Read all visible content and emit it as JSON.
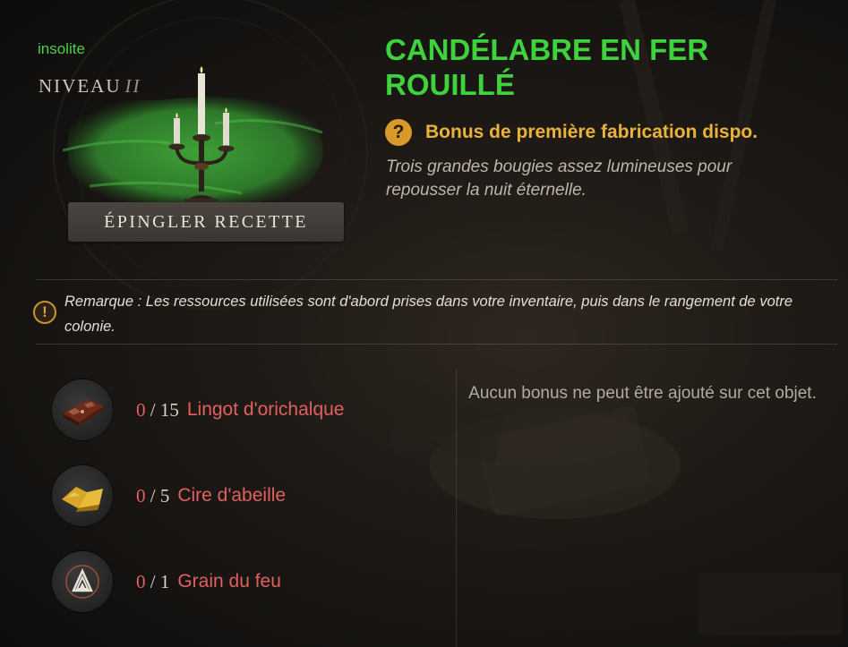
{
  "item": {
    "rarity": "insolite",
    "level_label": "NIVEAU",
    "level_roman": "II",
    "title": "CANDÉLABRE EN FER ROUILLÉ",
    "bonus": "Bonus de première fabrication dispo.",
    "description": "Trois grandes bougies assez lumineuses pour repousser la nuit éternelle."
  },
  "pin_button": "ÉPINGLER RECETTE",
  "note": "Remarque : Les ressources utilisées sont d'abord prises dans votre inventaire, puis dans le rangement de votre colonie.",
  "no_bonus": "Aucun bonus ne peut être ajouté sur cet objet.",
  "resources": [
    {
      "have": "0",
      "sep": " / ",
      "need": "15",
      "name": "Lingot d'orichalque",
      "icon": "orichalcum-ingot-icon"
    },
    {
      "have": "0",
      "sep": " / ",
      "need": "5",
      "name": "Cire d'abeille",
      "icon": "beeswax-icon"
    },
    {
      "have": "0",
      "sep": " / ",
      "need": "1",
      "name": "Grain du feu",
      "icon": "fire-mote-icon"
    }
  ],
  "colors": {
    "rarity": "#4ad14a",
    "title": "#3ed23c",
    "bonus": "#e9b23a",
    "missing": "#e06060"
  }
}
